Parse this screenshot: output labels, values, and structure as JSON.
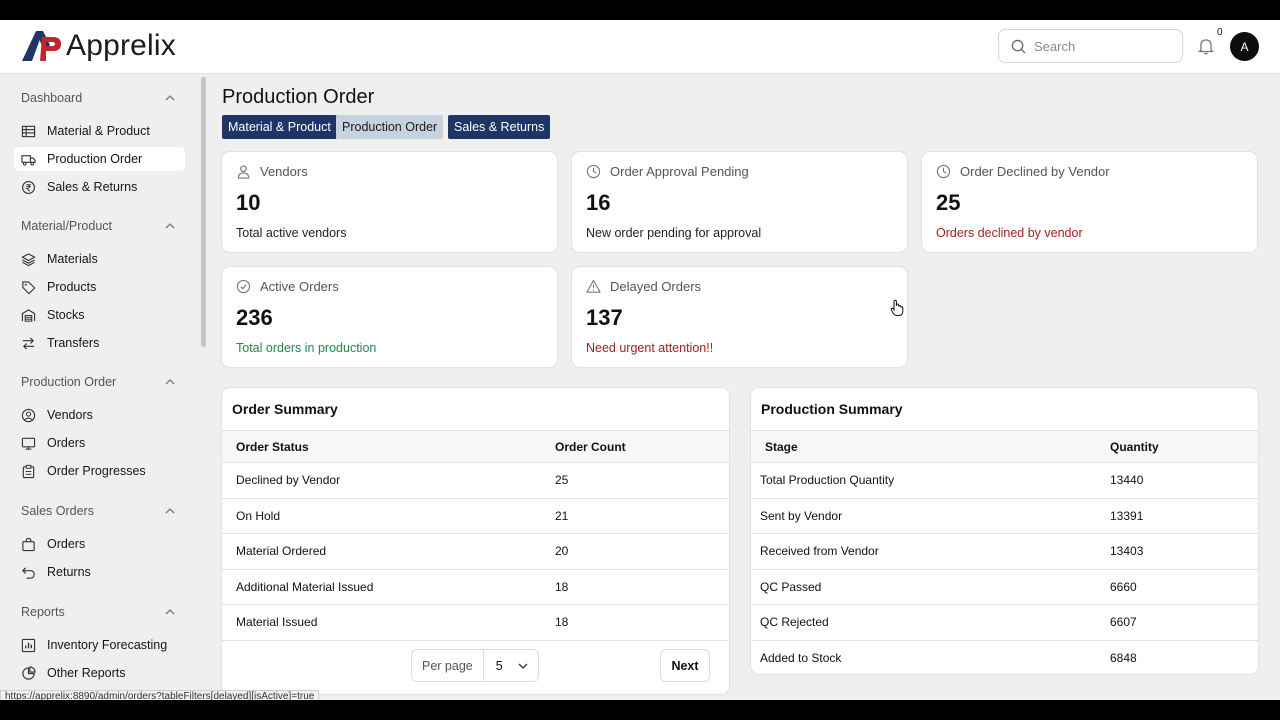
{
  "header": {
    "brand": "Apprelix",
    "search_placeholder": "Search",
    "notification_count": "0",
    "avatar_initial": "A"
  },
  "sidebar": {
    "sections": [
      {
        "title": "Dashboard",
        "items": [
          {
            "label": "Material & Product",
            "icon": "table-icon"
          },
          {
            "label": "Production Order",
            "icon": "truck-icon",
            "active": true
          },
          {
            "label": "Sales & Returns",
            "icon": "rupee-circle-icon"
          }
        ]
      },
      {
        "title": "Material/Product",
        "items": [
          {
            "label": "Materials",
            "icon": "layers-icon"
          },
          {
            "label": "Products",
            "icon": "tag-icon"
          },
          {
            "label": "Stocks",
            "icon": "warehouse-icon"
          },
          {
            "label": "Transfers",
            "icon": "arrows-swap-icon"
          }
        ]
      },
      {
        "title": "Production Order",
        "items": [
          {
            "label": "Vendors",
            "icon": "user-circle-icon"
          },
          {
            "label": "Orders",
            "icon": "monitor-icon"
          },
          {
            "label": "Order Progresses",
            "icon": "clipboard-icon"
          }
        ]
      },
      {
        "title": "Sales Orders",
        "items": [
          {
            "label": "Orders",
            "icon": "shopping-bag-icon"
          },
          {
            "label": "Returns",
            "icon": "return-arrow-icon"
          }
        ]
      },
      {
        "title": "Reports",
        "items": [
          {
            "label": "Inventory Forecasting",
            "icon": "bar-chart-icon"
          },
          {
            "label": "Other Reports",
            "icon": "pie-chart-icon"
          }
        ]
      }
    ]
  },
  "page": {
    "title": "Production Order",
    "tabs": [
      "Material & Product",
      "Production Order",
      "Sales & Returns"
    ]
  },
  "stats": [
    {
      "label": "Vendors",
      "value": "10",
      "sub": "Total active vendors",
      "icon": "user-icon",
      "tone": "normal"
    },
    {
      "label": "Order Approval Pending",
      "value": "16",
      "sub": "New order pending for approval",
      "icon": "clock-icon",
      "tone": "normal"
    },
    {
      "label": "Order Declined by Vendor",
      "value": "25",
      "sub": "Orders declined by vendor",
      "icon": "clock-icon",
      "tone": "red"
    },
    {
      "label": "Active Orders",
      "value": "236",
      "sub": "Total orders in production",
      "icon": "check-circle-icon",
      "tone": "green"
    },
    {
      "label": "Delayed Orders",
      "value": "137",
      "sub": "Need urgent attention!!",
      "icon": "warning-icon",
      "tone": "red"
    }
  ],
  "order_summary": {
    "title": "Order Summary",
    "columns": [
      "Order Status",
      "Order Count"
    ],
    "rows": [
      [
        "Declined by Vendor",
        "25"
      ],
      [
        "On Hold",
        "21"
      ],
      [
        "Material Ordered",
        "20"
      ],
      [
        "Additional Material Issued",
        "18"
      ],
      [
        "Material Issued",
        "18"
      ]
    ],
    "per_page_label": "Per page",
    "per_page_value": "5",
    "next_label": "Next"
  },
  "production_summary": {
    "title": "Production Summary",
    "columns": [
      "Stage",
      "Quantity"
    ],
    "rows": [
      [
        "Total Production Quantity",
        "13440"
      ],
      [
        "Sent by Vendor",
        "13391"
      ],
      [
        "Received from Vendor",
        "13403"
      ],
      [
        "QC Passed",
        "6660"
      ],
      [
        "QC Rejected",
        "6607"
      ],
      [
        "Added to Stock",
        "6848"
      ]
    ]
  },
  "status_url": "https://apprelix:8890/admin/orders?tableFilters[delayed][isActive]=true",
  "colors": {
    "accent_dark": "#1e3566",
    "accent_light": "#c8d2de",
    "danger": "#a1221f",
    "success": "#25834b"
  }
}
